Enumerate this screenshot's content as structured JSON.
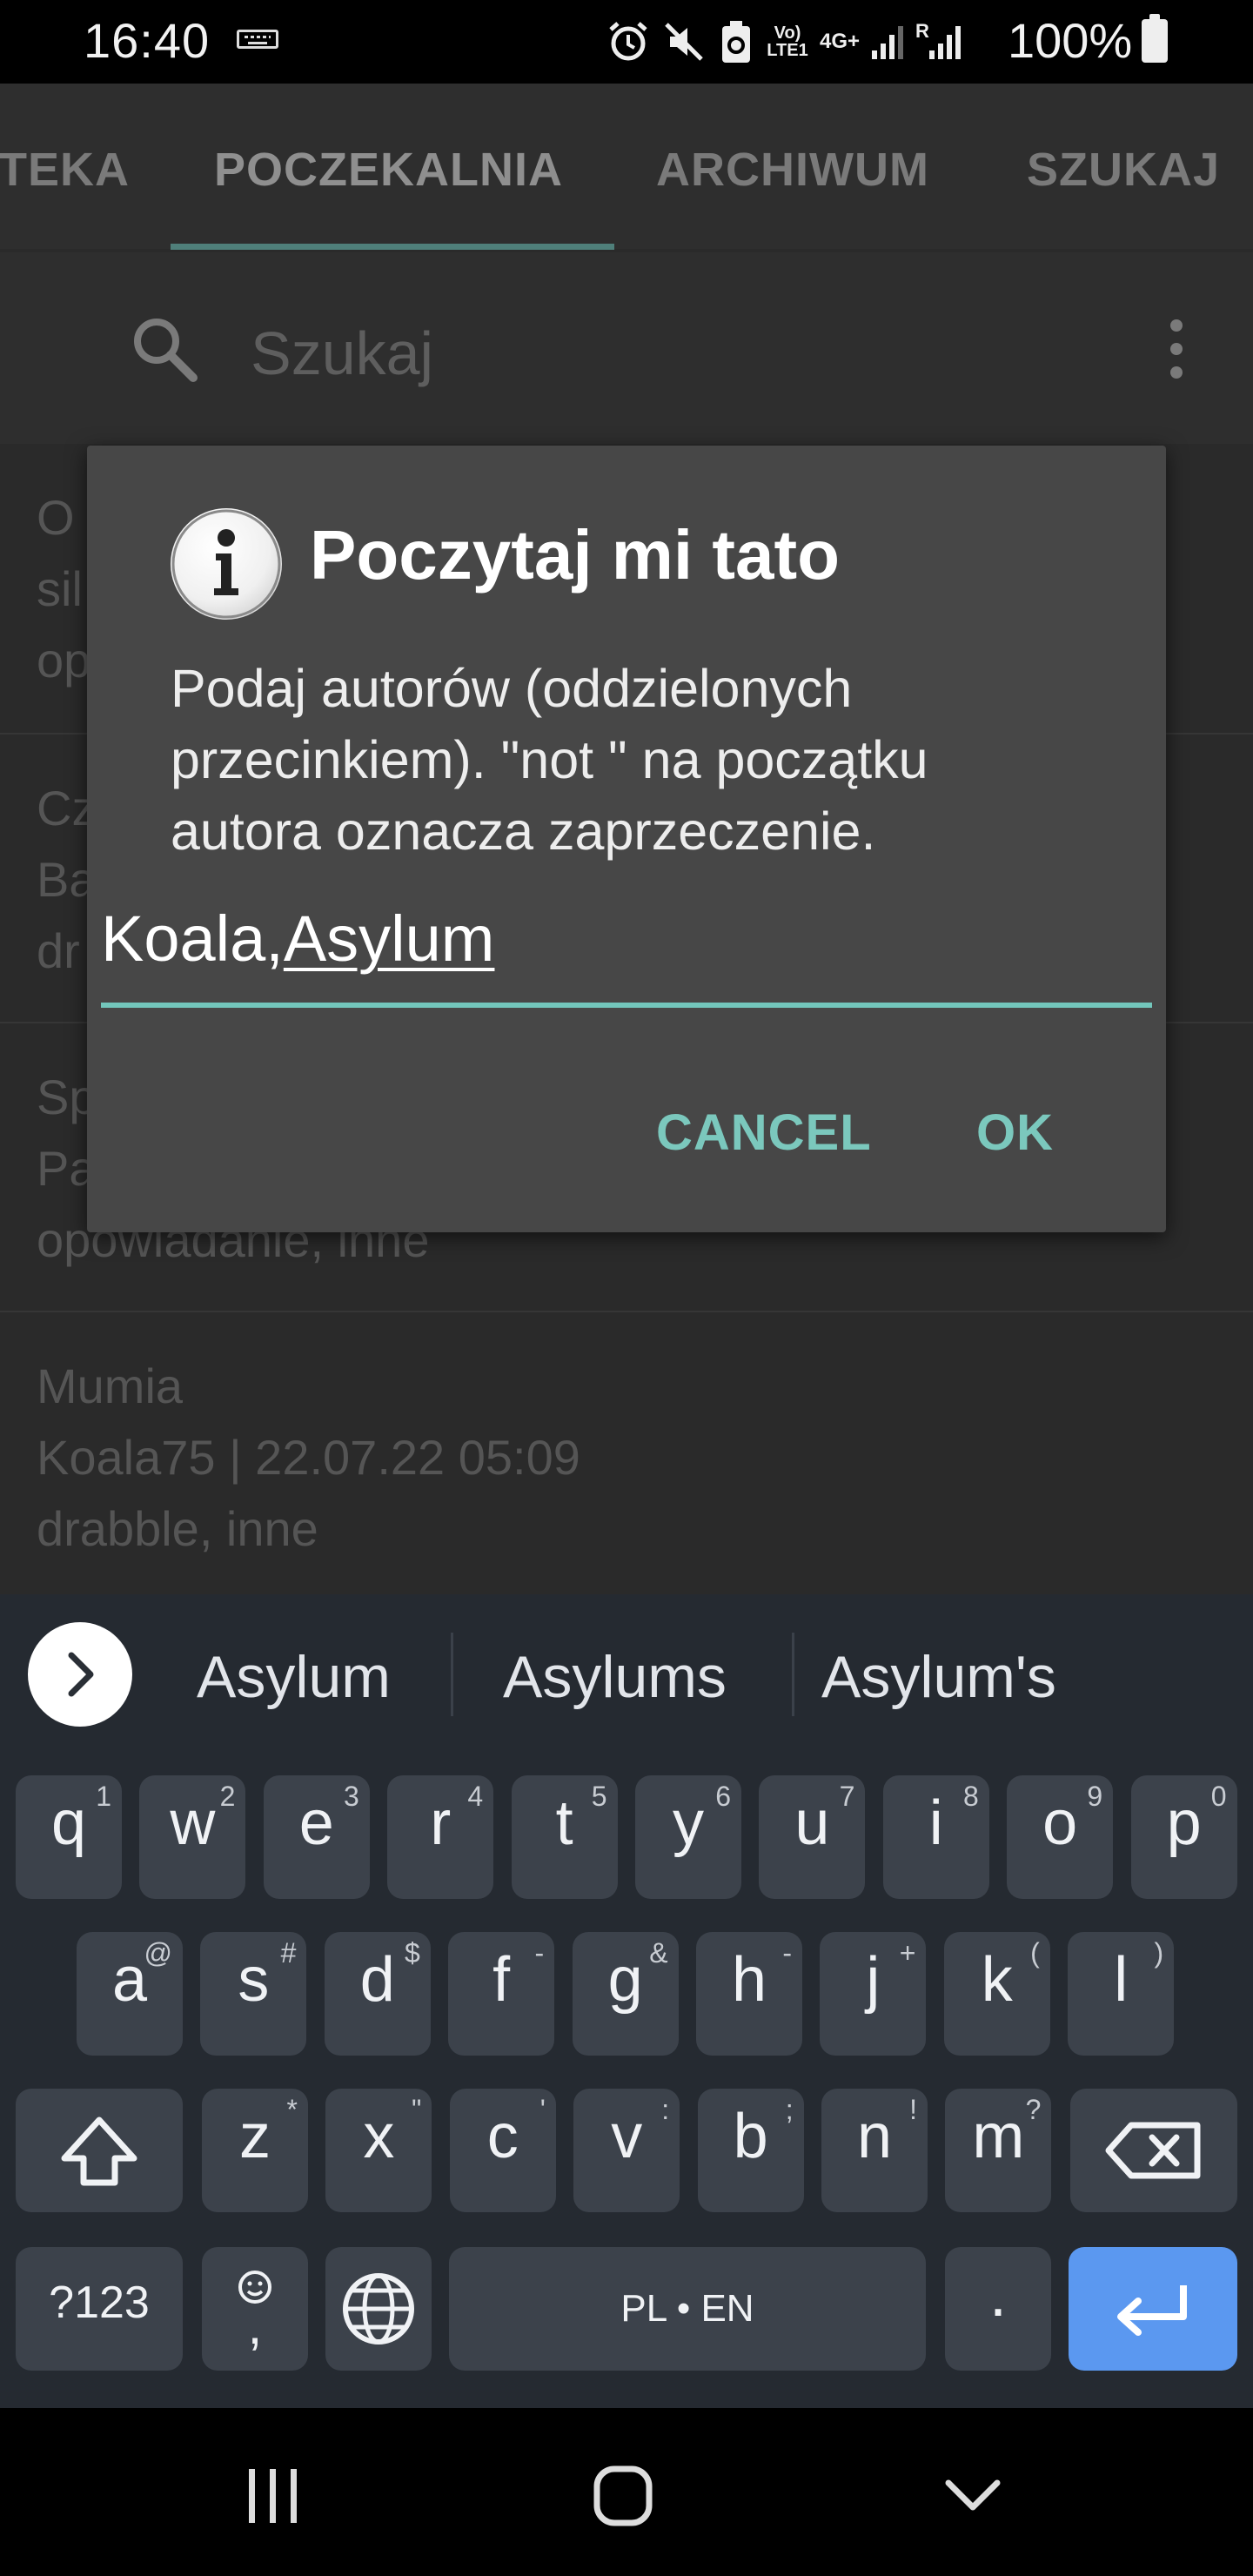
{
  "status_bar": {
    "time": "16:40",
    "battery_percent": "100%",
    "network_label": "4G+",
    "volte_label": "Vo) LTE1",
    "roaming_label": "R"
  },
  "tabs": [
    "TEKA",
    "POCZEKALNIA",
    "ARCHIWUM",
    "SZUKAJ"
  ],
  "search": {
    "placeholder": "Szukaj"
  },
  "list_items": [
    {
      "lines": [
        "O",
        "sil",
        "op"
      ]
    },
    {
      "lines": [
        "Cz",
        "Ba",
        "dr"
      ]
    },
    {
      "lines": [
        "Sp",
        "Pa",
        "opowiadanie, inne"
      ]
    },
    {
      "lines": [
        "Mumia",
        "Koala75 | 22.07.22 05:09",
        "drabble, inne"
      ]
    }
  ],
  "dialog": {
    "title": "Poczytaj mi tato",
    "message_lines": [
      "Podaj autorów (oddzielonych",
      "przecinkiem). \"not \" na początku",
      "autora oznacza zaprzeczenie."
    ],
    "input_prefix": "Koala,",
    "input_composing": "Asylum",
    "cancel_label": "CANCEL",
    "ok_label": "OK"
  },
  "keyboard": {
    "suggestions": [
      "Asylum",
      "Asylums",
      "Asylum's"
    ],
    "row1": [
      [
        "q",
        "1"
      ],
      [
        "w",
        "2"
      ],
      [
        "e",
        "3"
      ],
      [
        "r",
        "4"
      ],
      [
        "t",
        "5"
      ],
      [
        "y",
        "6"
      ],
      [
        "u",
        "7"
      ],
      [
        "i",
        "8"
      ],
      [
        "o",
        "9"
      ],
      [
        "p",
        "0"
      ]
    ],
    "row2": [
      [
        "a",
        "@"
      ],
      [
        "s",
        "#"
      ],
      [
        "d",
        "$"
      ],
      [
        "f",
        "-"
      ],
      [
        "g",
        "&"
      ],
      [
        "h",
        "-"
      ],
      [
        "j",
        "+"
      ],
      [
        "k",
        "("
      ],
      [
        "l",
        ")"
      ]
    ],
    "row3": [
      [
        "z",
        "*"
      ],
      [
        "x",
        "\""
      ],
      [
        "c",
        "'"
      ],
      [
        "v",
        ":"
      ],
      [
        "b",
        ";"
      ],
      [
        "n",
        "!"
      ],
      [
        "m",
        "?"
      ]
    ],
    "symbols_label": "?123",
    "emoji_comma": ",",
    "space_label": "PL • EN",
    "period_label": "."
  },
  "colors": {
    "accent": "#73c7bc",
    "button_text": "#7bc8bd",
    "enter_key": "#5b98f0",
    "dialog_bg": "#474747",
    "keyboard_bg": "#252a31"
  }
}
